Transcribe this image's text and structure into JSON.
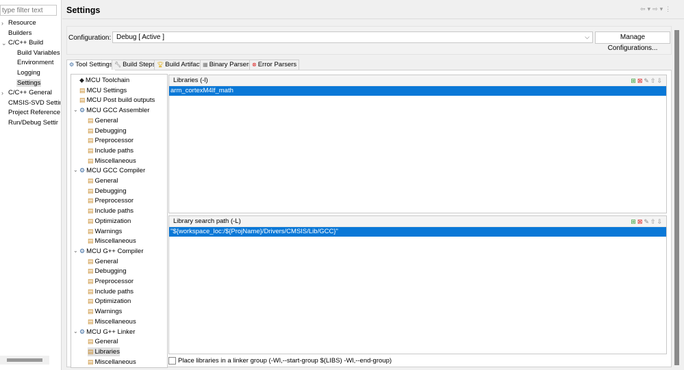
{
  "left_nav": {
    "filter_placeholder": "type filter text",
    "items": [
      {
        "label": "Resource",
        "expandable": true,
        "expanded": false,
        "level": 0
      },
      {
        "label": "Builders",
        "level": 0
      },
      {
        "label": "C/C++ Build",
        "expandable": true,
        "expanded": true,
        "level": 0
      },
      {
        "label": "Build Variables",
        "level": 1
      },
      {
        "label": "Environment",
        "level": 1
      },
      {
        "label": "Logging",
        "level": 1
      },
      {
        "label": "Settings",
        "level": 1,
        "selected": true
      },
      {
        "label": "C/C++ General",
        "expandable": true,
        "expanded": false,
        "level": 0
      },
      {
        "label": "CMSIS-SVD Settir",
        "level": 0
      },
      {
        "label": "Project Reference",
        "level": 0
      },
      {
        "label": "Run/Debug Settir",
        "level": 0
      }
    ]
  },
  "header": {
    "title": "Settings",
    "nav_icons": [
      "back-arrow-icon",
      "dropdown-icon",
      "forward-arrow-icon",
      "dropdown-icon",
      "more-icon"
    ]
  },
  "configuration": {
    "label": "Configuration:",
    "value": "Debug  [ Active ]",
    "manage_label": "Manage Configurations..."
  },
  "tabs": [
    {
      "label": "Tool Settings",
      "icon": "gear-icon",
      "active": true
    },
    {
      "label": "Build Steps",
      "icon": "wrench-icon"
    },
    {
      "label": "Build Artifact",
      "icon": "trophy-icon"
    },
    {
      "label": "Binary Parsers",
      "icon": "binary-icon"
    },
    {
      "label": "Error Parsers",
      "icon": "error-icon"
    }
  ],
  "tool_tree": [
    {
      "label": "MCU Toolchain",
      "level": 0,
      "icon": "chip-icon"
    },
    {
      "label": "MCU Settings",
      "level": 0,
      "icon": "settings-page-icon"
    },
    {
      "label": "MCU Post build outputs",
      "level": 0,
      "icon": "settings-page-icon"
    },
    {
      "label": "MCU GCC Assembler",
      "level": 0,
      "icon": "tool-icon",
      "expanded": true
    },
    {
      "label": "General",
      "level": 1
    },
    {
      "label": "Debugging",
      "level": 1
    },
    {
      "label": "Preprocessor",
      "level": 1
    },
    {
      "label": "Include paths",
      "level": 1
    },
    {
      "label": "Miscellaneous",
      "level": 1
    },
    {
      "label": "MCU GCC Compiler",
      "level": 0,
      "icon": "tool-icon",
      "expanded": true
    },
    {
      "label": "General",
      "level": 1
    },
    {
      "label": "Debugging",
      "level": 1
    },
    {
      "label": "Preprocessor",
      "level": 1
    },
    {
      "label": "Include paths",
      "level": 1
    },
    {
      "label": "Optimization",
      "level": 1
    },
    {
      "label": "Warnings",
      "level": 1
    },
    {
      "label": "Miscellaneous",
      "level": 1
    },
    {
      "label": "MCU G++ Compiler",
      "level": 0,
      "icon": "tool-icon",
      "expanded": true
    },
    {
      "label": "General",
      "level": 1
    },
    {
      "label": "Debugging",
      "level": 1
    },
    {
      "label": "Preprocessor",
      "level": 1
    },
    {
      "label": "Include paths",
      "level": 1
    },
    {
      "label": "Optimization",
      "level": 1
    },
    {
      "label": "Warnings",
      "level": 1
    },
    {
      "label": "Miscellaneous",
      "level": 1
    },
    {
      "label": "MCU G++ Linker",
      "level": 0,
      "icon": "tool-icon",
      "expanded": true
    },
    {
      "label": "General",
      "level": 1
    },
    {
      "label": "Libraries",
      "level": 1,
      "selected": true
    },
    {
      "label": "Miscellaneous",
      "level": 1
    }
  ],
  "libraries": {
    "title": "Libraries (-l)",
    "items": [
      "arm_cortexM4lf_math"
    ],
    "toolbar": [
      "add-icon",
      "delete-icon",
      "edit-icon",
      "move-up-icon",
      "move-down-icon"
    ]
  },
  "library_paths": {
    "title": "Library search path (-L)",
    "items": [
      "\"${workspace_loc:/${ProjName}/Drivers/CMSIS/Lib/GCC}\""
    ],
    "toolbar": [
      "add-icon",
      "delete-icon",
      "edit-icon",
      "move-up-icon",
      "move-down-icon"
    ]
  },
  "linker_group": {
    "label": "Place libraries in a linker group (-Wl,--start-group $(LIBS) -Wl,--end-group)",
    "checked": false
  },
  "colors": {
    "selection": "#0a78d7"
  }
}
